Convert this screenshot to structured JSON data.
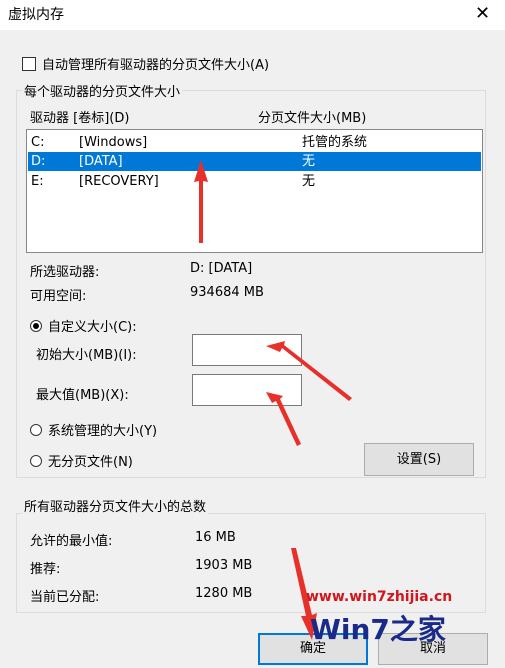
{
  "window": {
    "title": "虚拟内存",
    "close_glyph": "✕"
  },
  "auto_manage": {
    "label": "自动管理所有驱动器的分页文件大小(A)",
    "checked": false
  },
  "per_drive": {
    "group_label": "每个驱动器的分页文件大小",
    "columns": [
      "驱动器 [卷标](D)",
      "分页文件大小(MB)"
    ],
    "rows": [
      {
        "drive": "C:",
        "label": "[Windows]",
        "size": "托管的系统",
        "selected": false
      },
      {
        "drive": "D:",
        "label": "[DATA]",
        "size": "无",
        "selected": true
      },
      {
        "drive": "E:",
        "label": "[RECOVERY]",
        "size": "无",
        "selected": false
      }
    ],
    "selected_drive_label": "所选驱动器:",
    "selected_drive_value": "D:  [DATA]",
    "free_space_label": "可用空间:",
    "free_space_value": "934684 MB",
    "custom_size_label": "自定义大小(C):",
    "initial_size_label": "初始大小(MB)(I):",
    "initial_size_value": "",
    "max_size_label": "最大值(MB)(X):",
    "max_size_value": "",
    "system_managed_label": "系统管理的大小(Y)",
    "no_paging_label": "无分页文件(N)",
    "set_button": "设置(S)",
    "selected_option": "custom"
  },
  "totals": {
    "group_label": "所有驱动器分页文件大小的总数",
    "min_allowed_label": "允许的最小值:",
    "min_allowed_value": "16 MB",
    "recommended_label": "推荐:",
    "recommended_value": "1903 MB",
    "currently_allocated_label": "当前已分配:",
    "currently_allocated_value": "1280 MB"
  },
  "buttons": {
    "ok": "确定",
    "cancel": "取消"
  },
  "watermark": {
    "url": "www.win7zhijia.cn",
    "logo_text": "Win7之家"
  },
  "colors": {
    "selection": "#0078d7",
    "annotation_arrow": "#e8302b",
    "watermark": "#d2161c"
  }
}
